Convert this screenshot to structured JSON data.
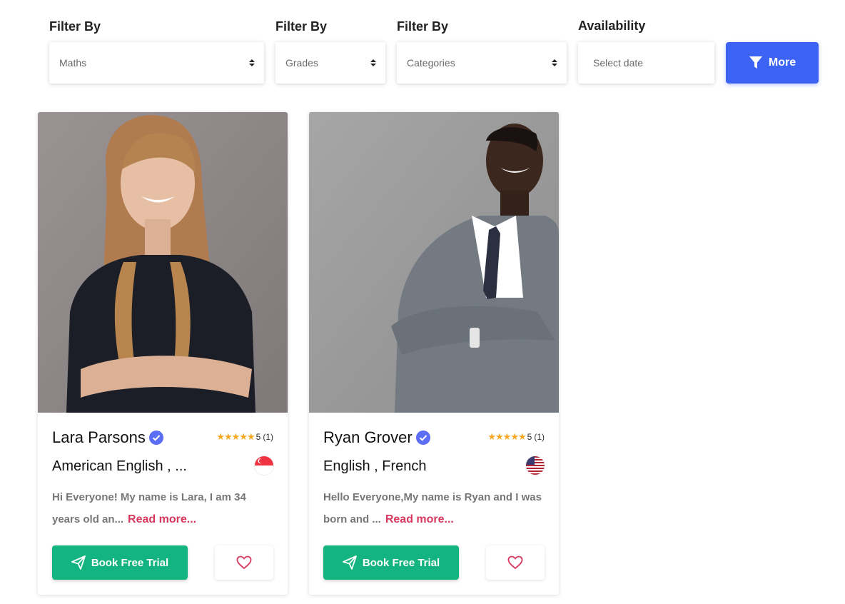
{
  "filters": {
    "subject": {
      "label": "Filter By",
      "value": "Maths"
    },
    "grades": {
      "label": "Filter By",
      "value": "Grades"
    },
    "categories": {
      "label": "Filter By",
      "value": "Categories"
    },
    "availability": {
      "label": "Availability",
      "placeholder": "Select date"
    },
    "more_label": "More"
  },
  "tutors": [
    {
      "name": "Lara Parsons",
      "rating": "5",
      "reviews": "(1)",
      "languages": "American English , ...",
      "flag": "singapore-flag-icon",
      "bio": "Hi Everyone! My name is Lara, I am 34 years old an...",
      "read_more": "Read more...",
      "book_label": "Book Free Trial"
    },
    {
      "name": "Ryan Grover",
      "rating": "5",
      "reviews": "(1)",
      "languages": "English , French",
      "flag": "usa-flag-icon",
      "bio": "Hello Everyone,My name is Ryan and I was born and ...",
      "read_more": "Read more...",
      "book_label": "Book Free Trial"
    }
  ],
  "colors": {
    "primary": "#3d63f5",
    "book": "#13b47f",
    "read_more": "#d7385e",
    "star": "#f5a623",
    "verified": "#5b6ef5"
  }
}
